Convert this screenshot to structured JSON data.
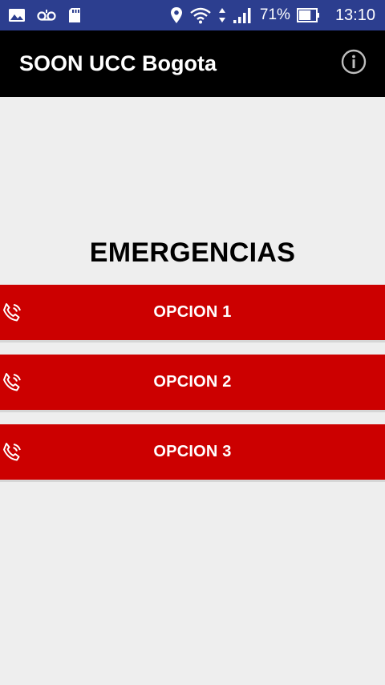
{
  "status_bar": {
    "battery_percent_label": "71%",
    "battery_level": 0.71,
    "time": "13:10",
    "icons_left": [
      "image-icon",
      "voicemail-icon",
      "sd-card-icon"
    ],
    "icons_right": [
      "location-icon",
      "wifi-icon",
      "data-arrows-icon",
      "signal-icon",
      "battery-icon"
    ],
    "color": "#2c3e8f"
  },
  "app_bar": {
    "title": "SOON UCC Bogota",
    "info_icon": "info-icon",
    "color": "#000000"
  },
  "main": {
    "heading": "EMERGENCIAS",
    "options": [
      {
        "label": "OPCION 1",
        "icon": "phone-icon"
      },
      {
        "label": "OPCION 2",
        "icon": "phone-icon"
      },
      {
        "label": "OPCION 3",
        "icon": "phone-icon"
      }
    ],
    "option_color": "#cc0000",
    "background": "#eeeeee"
  }
}
